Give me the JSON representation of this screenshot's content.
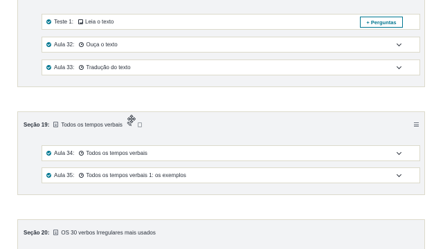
{
  "lectures_top": [
    {
      "label": "Teste 1:",
      "title": "Leia o texto",
      "type": "quiz",
      "button": "+ Perguntas"
    },
    {
      "label": "Aula 32:",
      "title": "Ouça o texto",
      "type": "video"
    },
    {
      "label": "Aula 33:",
      "title": "Tradução do texto",
      "type": "video"
    }
  ],
  "section_19": {
    "label": "Seção 19:",
    "title": "Todos os tempos verbais",
    "items": [
      {
        "label": "Aula 34:",
        "title": "Todos os tempos verbais",
        "type": "video"
      },
      {
        "label": "Aula 35:",
        "title": "Todos os tempos verbais 1: os exemplos",
        "type": "video"
      }
    ]
  },
  "section_20": {
    "label": "Seção 20:",
    "title": "OS 30 verbos Irregulares mais usados"
  },
  "colors": {
    "accent": "#007791",
    "section_bg": "#f2f3f5",
    "border": "#dcdacb",
    "text": "#29303b"
  },
  "icons": {
    "complete": "check-circle-icon",
    "quiz": "quiz-check-icon",
    "video": "play-circle-icon",
    "expand": "chevron-down-icon",
    "drag": "hamburger-icon",
    "cursor": "move-cursor-icon"
  }
}
